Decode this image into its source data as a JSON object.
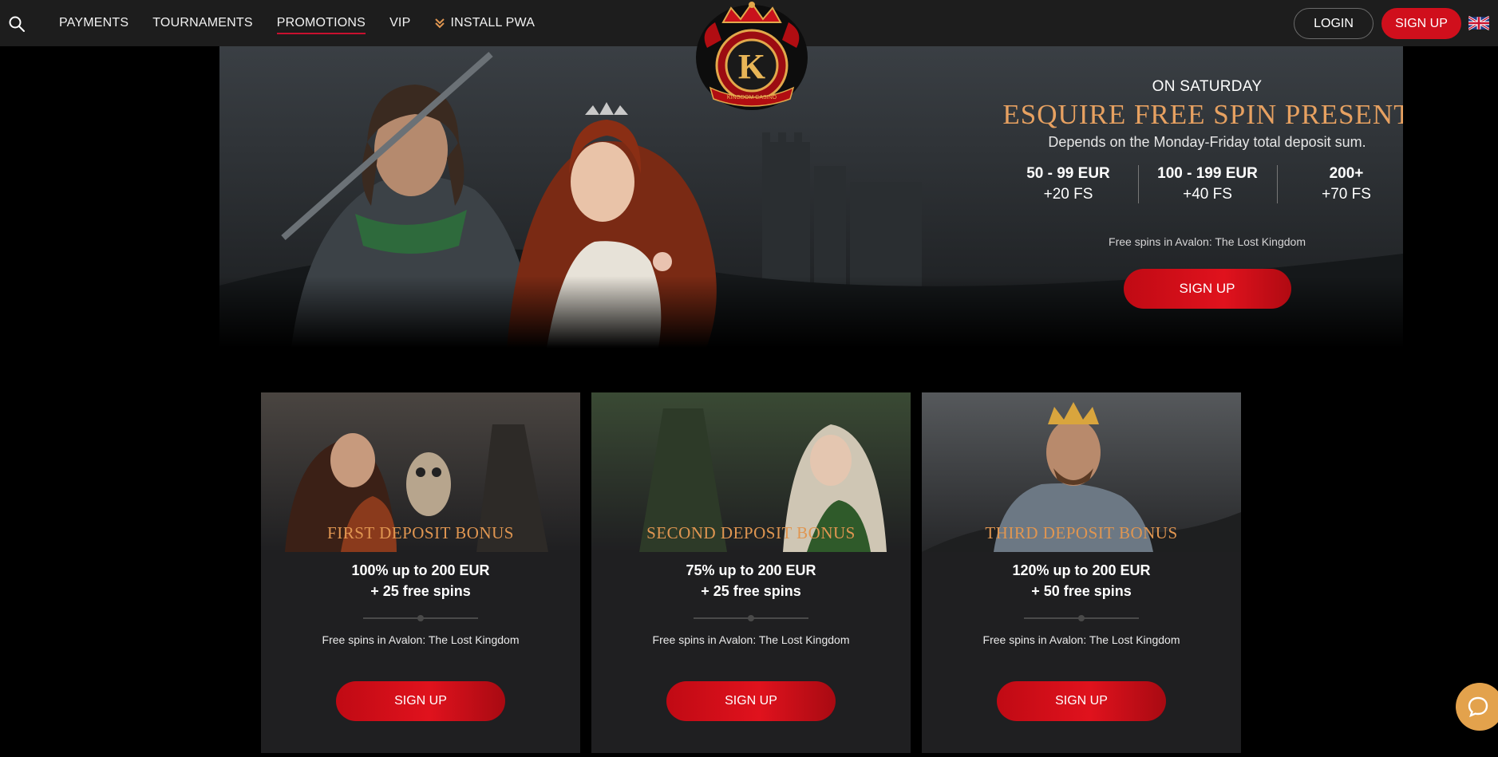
{
  "header": {
    "nav": [
      {
        "label": "PAYMENTS"
      },
      {
        "label": "TOURNAMENTS"
      },
      {
        "label": "PROMOTIONS",
        "active": true
      },
      {
        "label": "VIP"
      },
      {
        "label": "INSTALL PWA",
        "icon": "chevrons-down-icon"
      }
    ],
    "login_label": "LOGIN",
    "signup_label": "SIGN UP",
    "logo_letter": "K",
    "logo_text": "KINGDOM CASINO",
    "language_icon": "uk-flag-icon"
  },
  "hero": {
    "subtitle": "ON SATURDAY",
    "title": "ESQUIRE FREE SPIN PRESENT",
    "description": "Depends on the Monday-Friday total deposit sum.",
    "tiers": [
      {
        "range": "50 - 99 EUR",
        "spins": "+20 FS"
      },
      {
        "range": "100 - 199 EUR",
        "spins": "+40 FS"
      },
      {
        "range": "200+",
        "spins": "+70 FS"
      }
    ],
    "note": "Free spins in Avalon: The Lost Kingdom",
    "cta_label": "SIGN UP"
  },
  "cards": [
    {
      "title": "FIRST DEPOSIT BONUS",
      "offer_line1": "100% up to 200 EUR",
      "offer_line2": "+ 25 free spins",
      "note": "Free spins in Avalon: The Lost Kingdom",
      "cta_label": "SIGN UP"
    },
    {
      "title": "SECOND DEPOSIT BONUS",
      "offer_line1": "75% up to 200 EUR",
      "offer_line2": "+ 25 free spins",
      "note": "Free spins in Avalon: The Lost Kingdom",
      "cta_label": "SIGN UP"
    },
    {
      "title": "THIRD DEPOSIT BONUS",
      "offer_line1": "120% up to 200 EUR",
      "offer_line2": "+ 50 free spins",
      "note": "Free spins in Avalon: The Lost Kingdom",
      "cta_label": "SIGN UP"
    }
  ],
  "colors": {
    "accent_red": "#d00f1c",
    "gold": "#e7a161",
    "header_bg": "#1d1d1d",
    "chat": "#e3a24c"
  },
  "chat": {
    "icon": "chat-bubble-icon"
  }
}
